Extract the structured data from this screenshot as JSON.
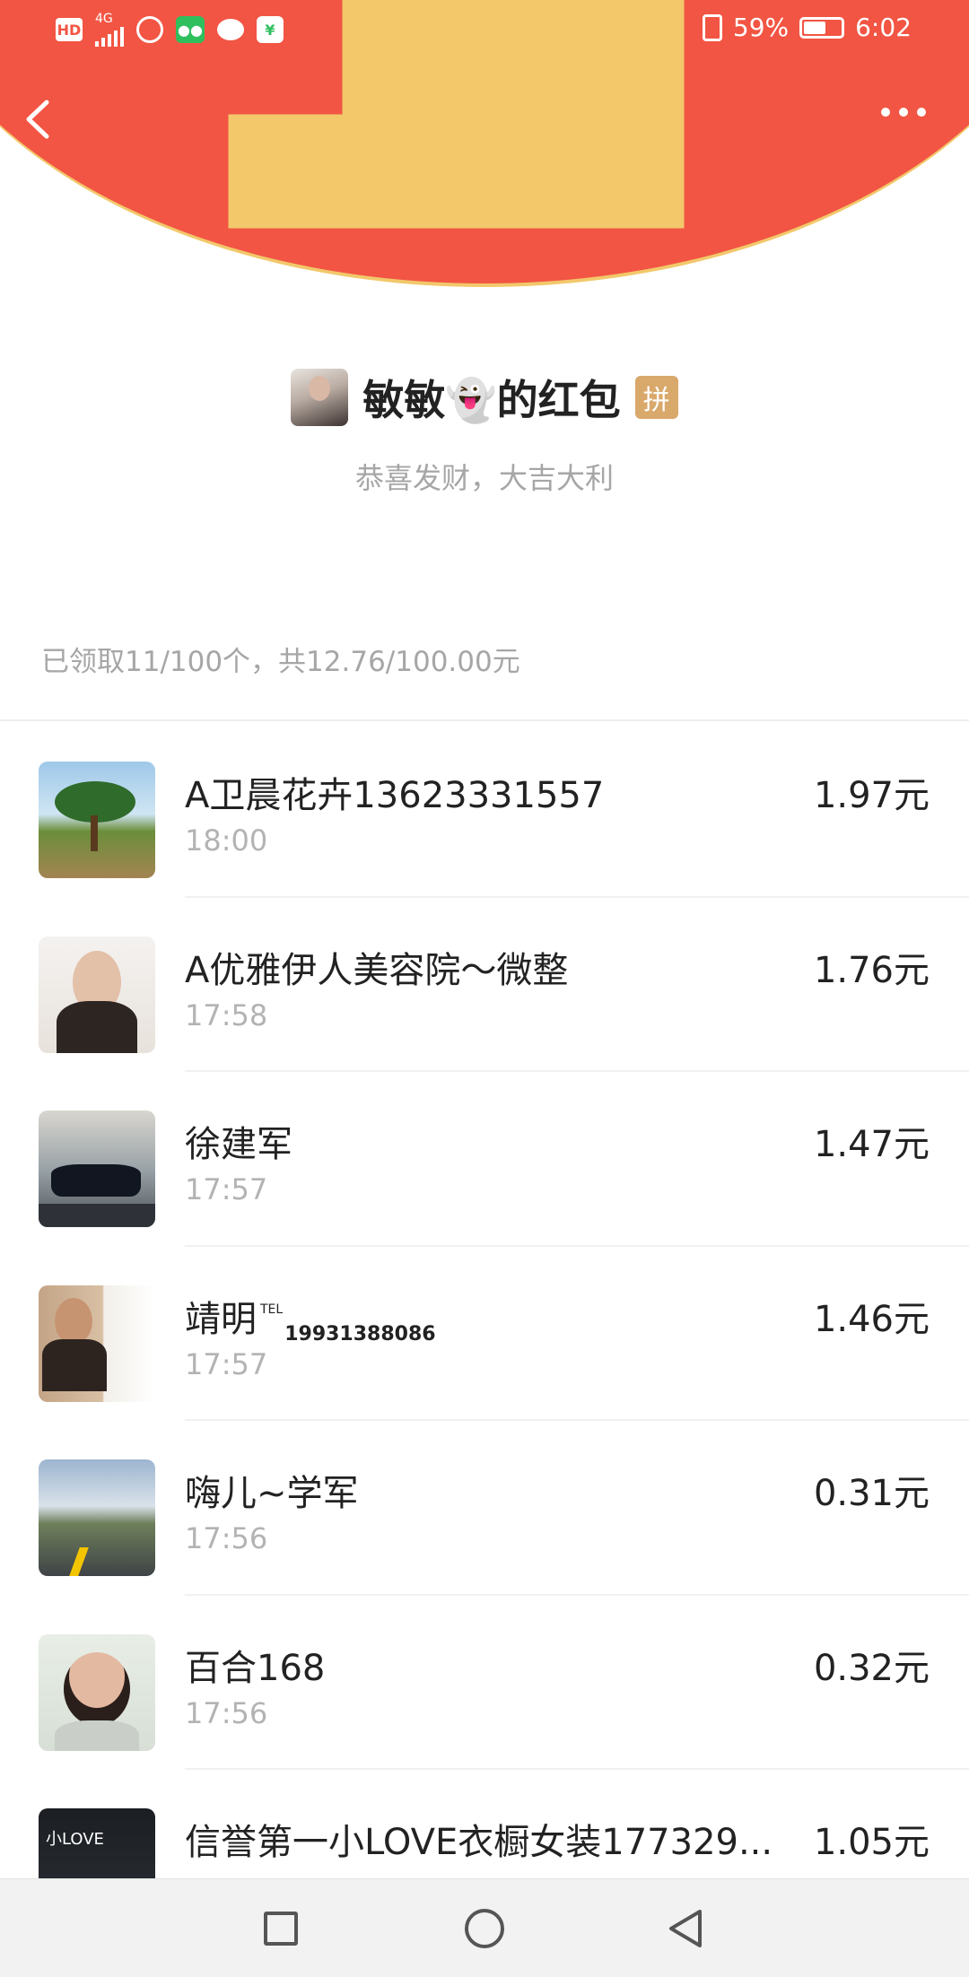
{
  "status_bar": {
    "hd": "HD",
    "network": "4G",
    "battery_percent": "59%",
    "time": "6:02"
  },
  "nav": {
    "back_icon": "chevron-left-icon",
    "more_icon": "more-dots-icon"
  },
  "sender": {
    "name": "敏敏👻的红包",
    "badge": "拼",
    "greeting": "恭喜发财，大吉大利"
  },
  "summary": "已领取11/100个，共12.76/100.00元",
  "records": [
    {
      "name": "A卫晨花卉13623331557",
      "time": "18:00",
      "amount": "1.97元"
    },
    {
      "name": "A优雅伊人美容院～微整",
      "time": "17:58",
      "amount": "1.76元"
    },
    {
      "name": "徐建军",
      "time": "17:57",
      "amount": "1.47元"
    },
    {
      "name": "靖明",
      "name_tel": "TEL",
      "name_phone": "19931388086",
      "time": "17:57",
      "amount": "1.46元"
    },
    {
      "name": "嗨儿~学军",
      "time": "17:56",
      "amount": "0.31元"
    },
    {
      "name": "百合168",
      "time": "17:56",
      "amount": "0.32元"
    },
    {
      "name": "信誉第一小LOVE衣橱女装177329...",
      "time": "",
      "amount": "1.05元"
    }
  ],
  "colors": {
    "banner": "#f25543",
    "banner_edge": "#f2c86b",
    "badge": "#d9a86b"
  }
}
